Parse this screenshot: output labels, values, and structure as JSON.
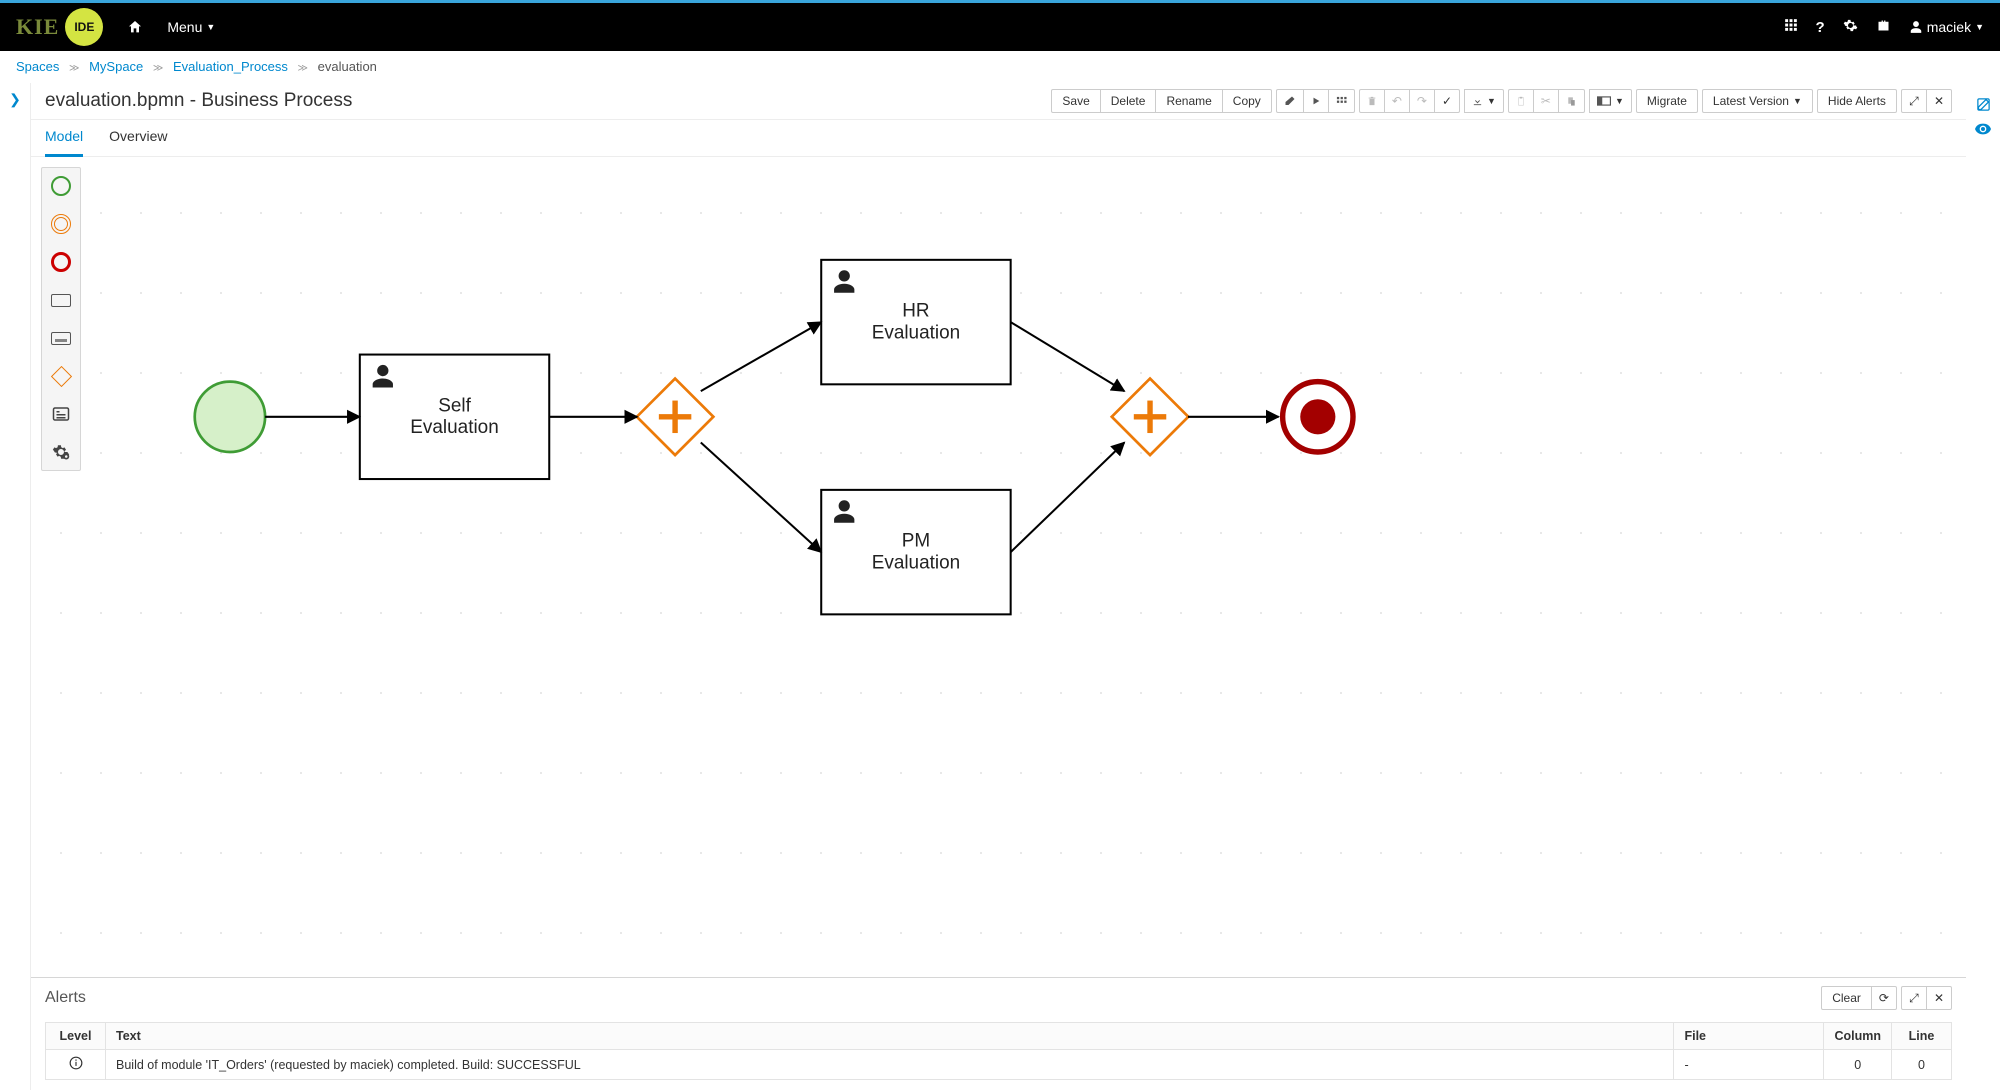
{
  "brand": {
    "kie": "KIE",
    "ide": "IDE"
  },
  "nav": {
    "menu": "Menu",
    "user": "maciek"
  },
  "breadcrumb": {
    "items": [
      "Spaces",
      "MySpace",
      "Evaluation_Process"
    ],
    "current": "evaluation"
  },
  "page": {
    "title": "evaluation.bpmn - Business Process"
  },
  "toolbar": {
    "save": "Save",
    "delete": "Delete",
    "rename": "Rename",
    "copy": "Copy",
    "migrate": "Migrate",
    "latest_version": "Latest Version",
    "hide_alerts": "Hide Alerts"
  },
  "tabs": {
    "model": "Model",
    "overview": "Overview"
  },
  "diagram": {
    "tasks": {
      "self": "Self\nEvaluation",
      "hr": "HR\nEvaluation",
      "pm": "PM\nEvaluation"
    }
  },
  "alerts": {
    "title": "Alerts",
    "clear": "Clear",
    "columns": {
      "level": "Level",
      "text": "Text",
      "file": "File",
      "column": "Column",
      "line": "Line"
    },
    "rows": [
      {
        "level": "info",
        "text": "Build of module 'IT_Orders' (requested by maciek) completed. Build: SUCCESSFUL",
        "file": "-",
        "column": "0",
        "line": "0"
      }
    ]
  }
}
